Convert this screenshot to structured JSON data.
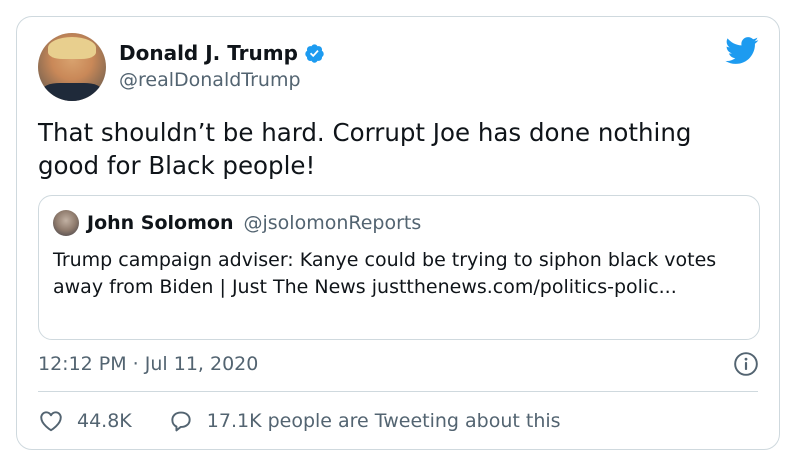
{
  "tweet": {
    "author_name": "Donald J. Trump",
    "author_handle": "@realDonaldTrump",
    "text": "That shouldn’t be hard. Corrupt Joe has done nothing good for Black people!",
    "timestamp": "12:12 PM · Jul 11, 2020"
  },
  "quote": {
    "author_name": "John Solomon",
    "author_handle": "@jsolomonReports",
    "text": "Trump campaign adviser: Kanye could be trying to siphon black votes away from Biden | Just The News justthenews.com/politics-polic..."
  },
  "actions": {
    "likes": "44.8K",
    "tweeting": "17.1K people are Tweeting about this"
  },
  "icons": {
    "verified": "verified-badge-icon",
    "brand": "twitter-bird-icon",
    "info": "info-icon",
    "like": "heart-icon",
    "reply": "speech-bubble-icon"
  },
  "colors": {
    "brand_blue": "#1d9bf0",
    "text": "#0f1419",
    "secondary_text": "#536471",
    "border": "#cfd9de"
  }
}
